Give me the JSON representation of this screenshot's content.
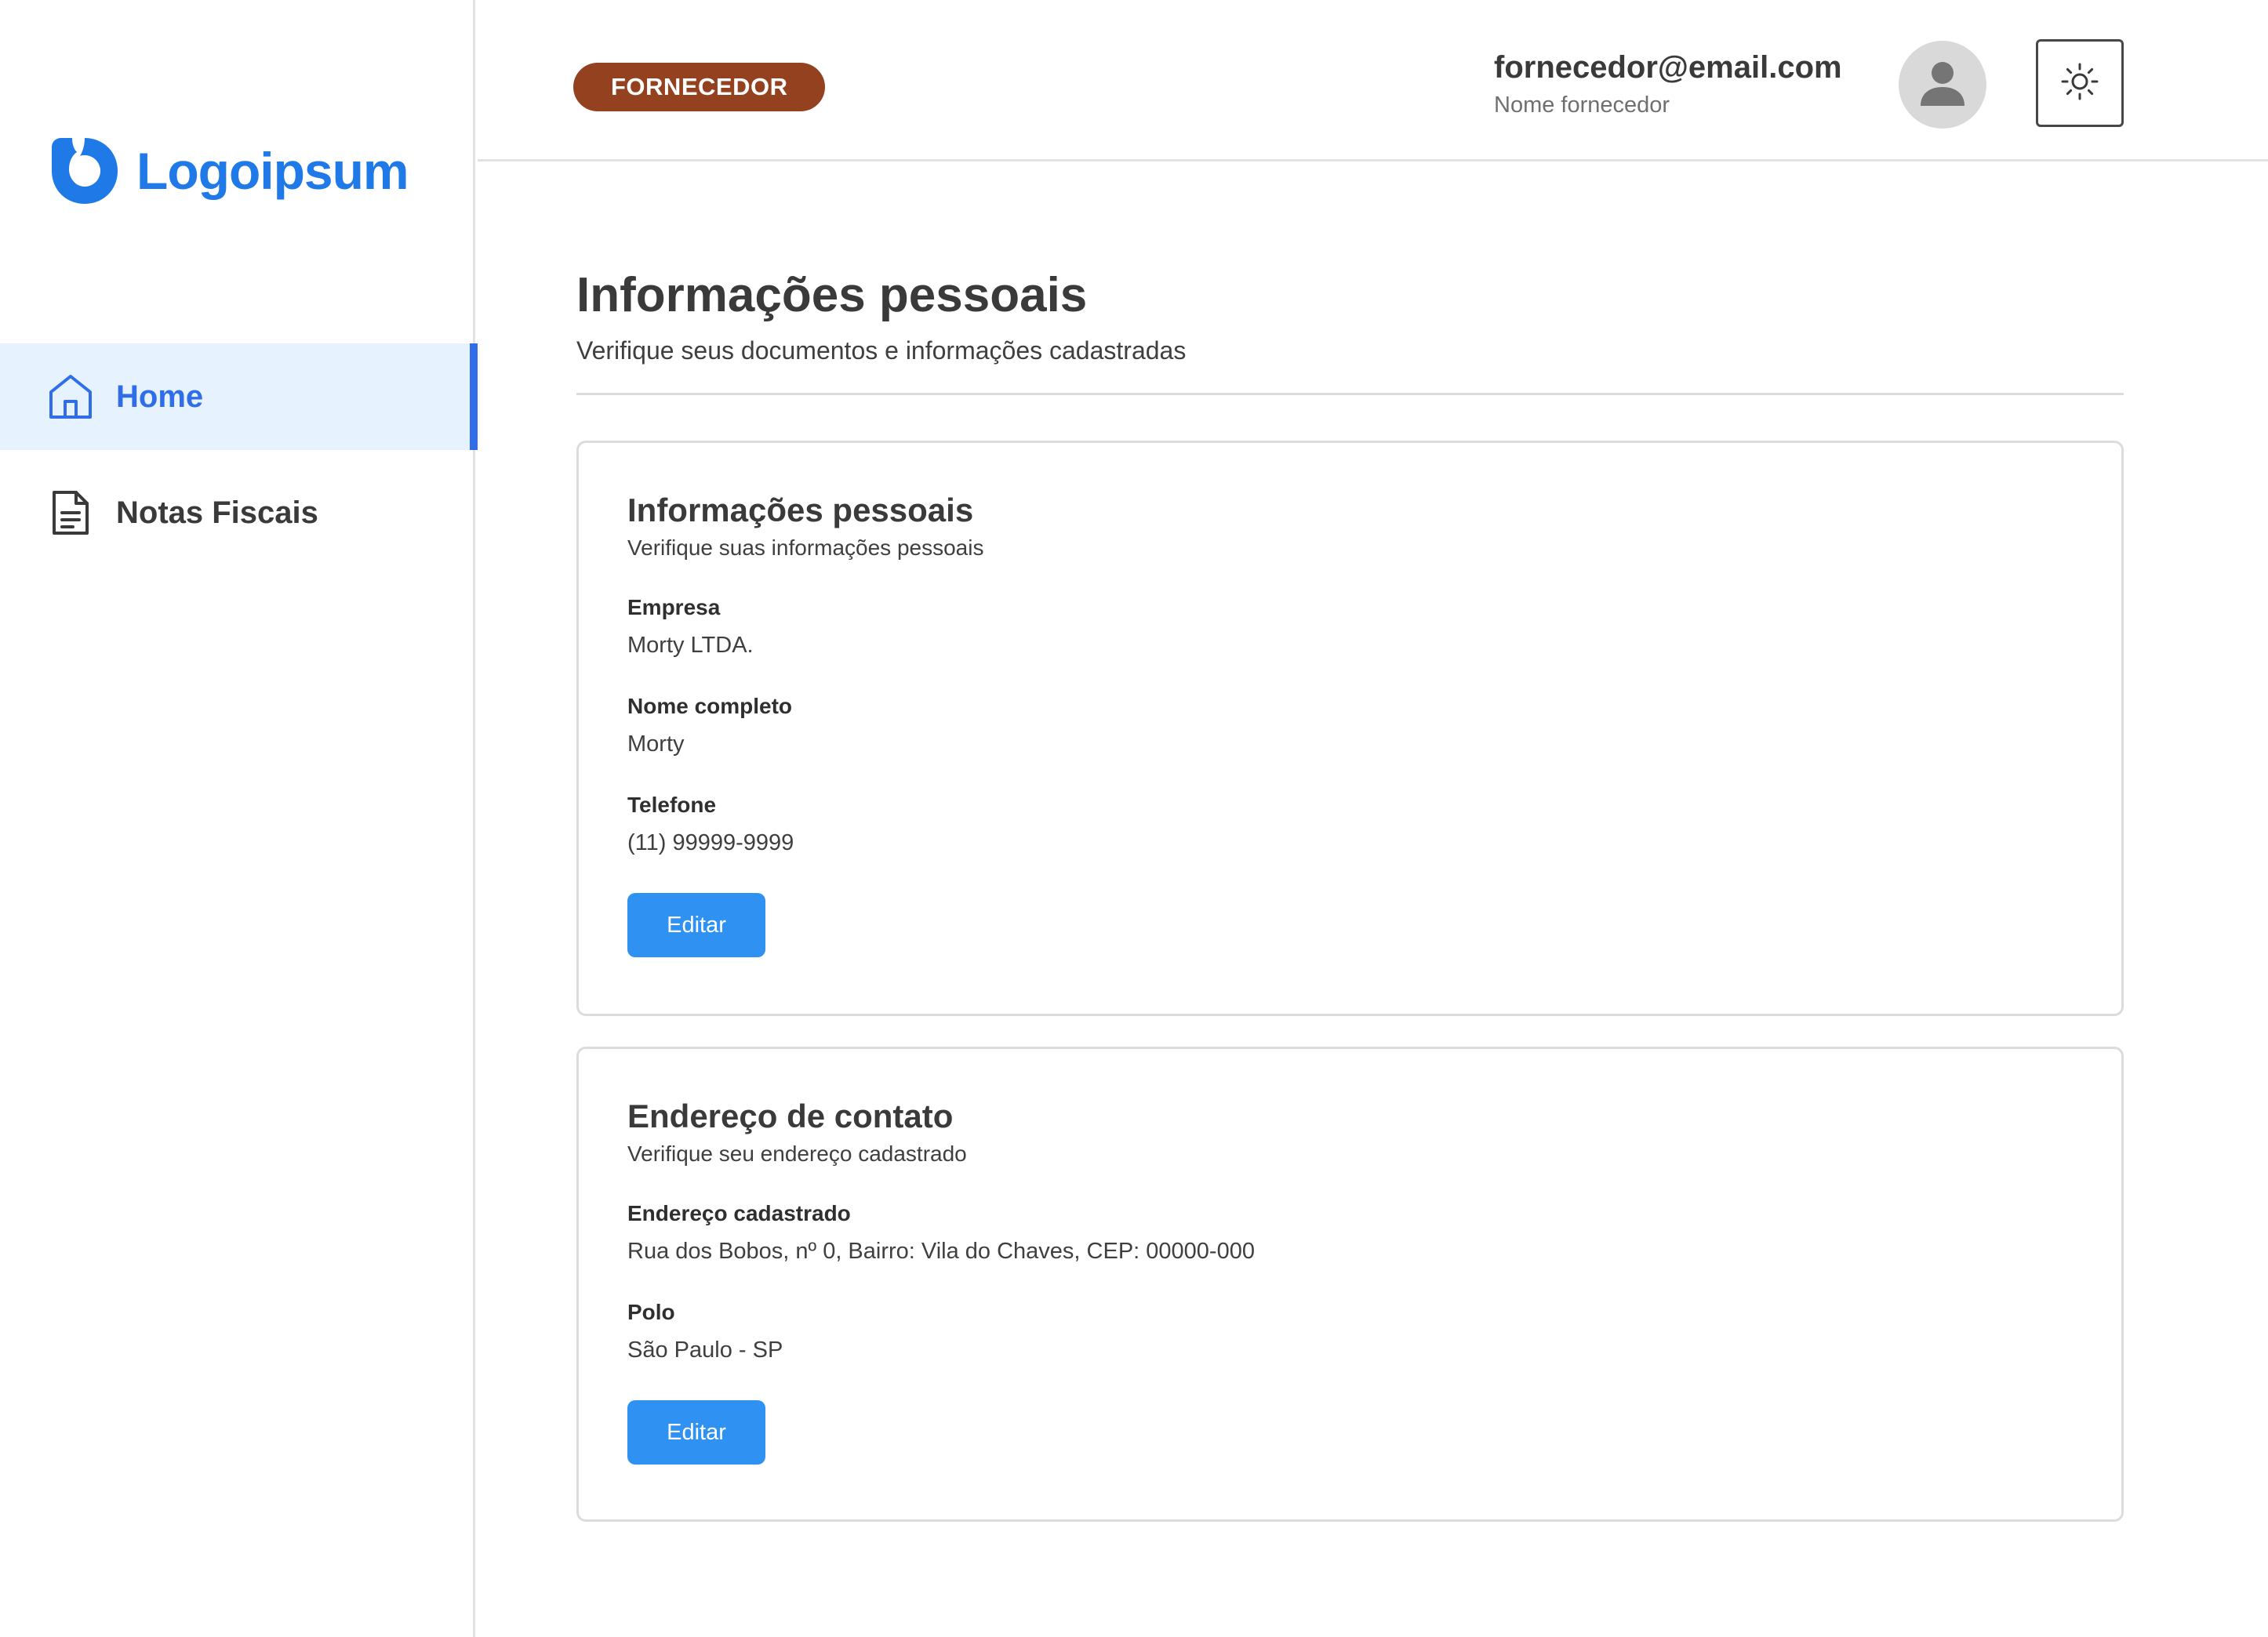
{
  "colors": {
    "brand": "#1f7ae8",
    "nav_active": "#2f6ee8",
    "nav_active_bg": "#e6f2fd",
    "role_badge_bg": "#93411f",
    "button_bg": "#2f92f3"
  },
  "sidebar": {
    "logo": {
      "text": "Logoipsum",
      "icon": "logo-mark-icon"
    },
    "items": [
      {
        "label": "Home",
        "icon": "home-icon",
        "active": true
      },
      {
        "label": "Notas Fiscais",
        "icon": "document-icon",
        "active": false
      }
    ]
  },
  "header": {
    "role_badge": "FORNECEDOR",
    "user_email": "fornecedor@email.com",
    "user_name": "Nome fornecedor",
    "avatar_icon": "user-avatar-icon",
    "theme_toggle_icon": "sun-icon"
  },
  "page": {
    "title": "Informações pessoais",
    "subtitle": "Verifique seus documentos e informações cadastradas"
  },
  "cards": [
    {
      "title": "Informações pessoais",
      "subtitle": "Verifique suas informações pessoais",
      "fields": [
        {
          "label": "Empresa",
          "value": "Morty LTDA."
        },
        {
          "label": "Nome completo",
          "value": "Morty"
        },
        {
          "label": "Telefone",
          "value": "(11) 99999-9999"
        }
      ],
      "button_label": "Editar"
    },
    {
      "title": "Endereço de contato",
      "subtitle": "Verifique seu endereço cadastrado",
      "fields": [
        {
          "label": "Endereço cadastrado",
          "value": "Rua dos Bobos, nº 0, Bairro: Vila do Chaves, CEP: 00000-000"
        },
        {
          "label": "Polo",
          "value": "São Paulo - SP"
        }
      ],
      "button_label": "Editar"
    }
  ]
}
